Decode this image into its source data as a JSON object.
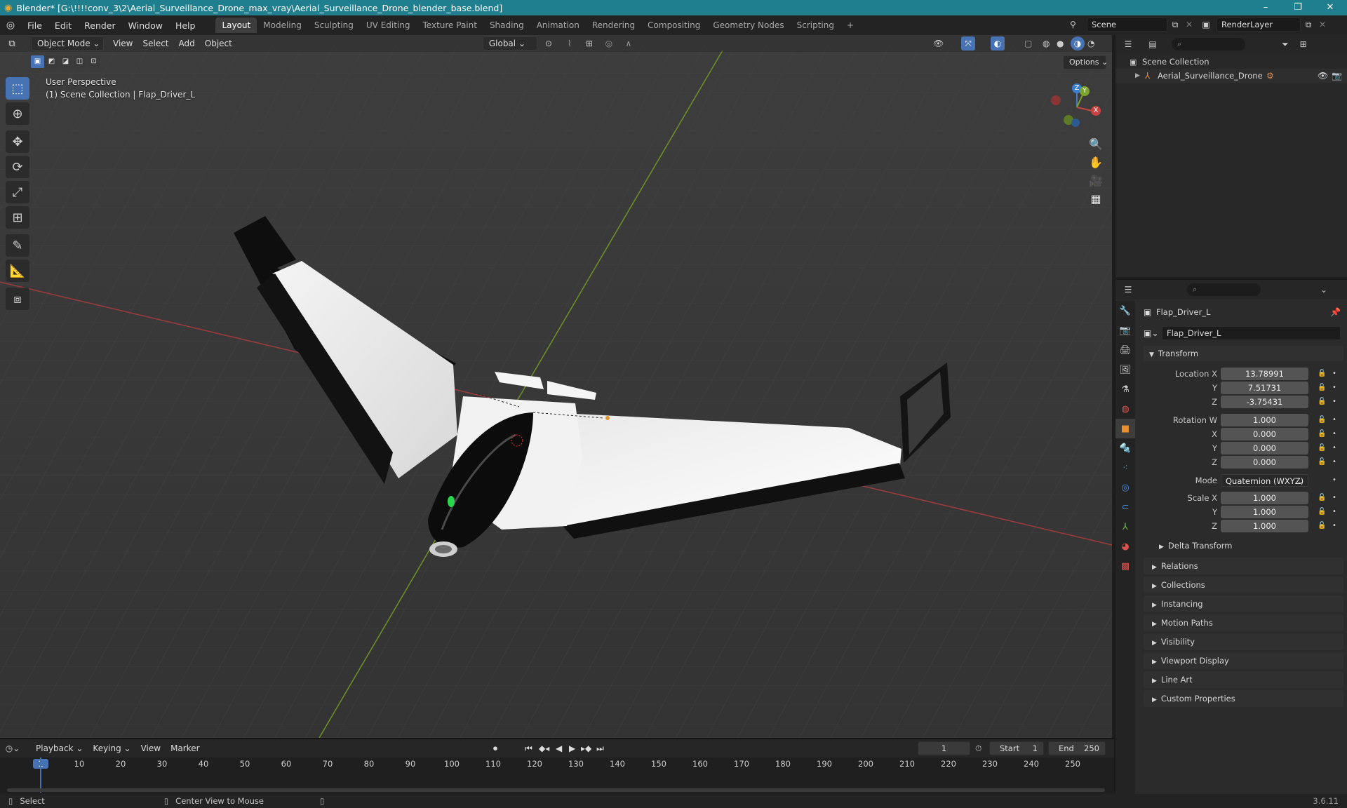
{
  "window": {
    "title": "Blender* [G:\\!!!!conv_3\\2\\Aerial_Surveillance_Drone_max_vray\\Aerial_Surveillance_Drone_blender_base.blend]",
    "minimize": "–",
    "restore": "❐",
    "close": "✕"
  },
  "menu": [
    "File",
    "Edit",
    "Render",
    "Window",
    "Help"
  ],
  "workspaces": {
    "tabs": [
      "Layout",
      "Modeling",
      "Sculpting",
      "UV Editing",
      "Texture Paint",
      "Shading",
      "Animation",
      "Rendering",
      "Compositing",
      "Geometry Nodes",
      "Scripting"
    ],
    "active": "Layout",
    "add": "+"
  },
  "scene": {
    "name": "Scene",
    "render_layer": "RenderLayer"
  },
  "viewport_header": {
    "mode": "Object Mode",
    "menus": [
      "View",
      "Select",
      "Add",
      "Object"
    ],
    "orientation": "Global",
    "options": "Options"
  },
  "viewport": {
    "perspective": "User Perspective",
    "collection_info": "(1) Scene Collection | Flap_Driver_L",
    "gizmo": {
      "z": "Z",
      "y": "Y",
      "x": "X"
    }
  },
  "outliner": {
    "scene_collection": "Scene Collection",
    "object": "Aerial_Surveillance_Drone"
  },
  "properties": {
    "object_name": "Flap_Driver_L",
    "datablock_name": "Flap_Driver_L",
    "transform": {
      "header": "Transform",
      "location_label": "Location X",
      "location": {
        "x": "13.78991",
        "y": "7.51731",
        "z": "-3.75431"
      },
      "rotation_label": "Rotation W",
      "rotation": {
        "w": "1.000",
        "x": "0.000",
        "y": "0.000",
        "z": "0.000"
      },
      "mode_label": "Mode",
      "mode": "Quaternion (WXYZ)",
      "scale_label": "Scale X",
      "scale": {
        "x": "1.000",
        "y": "1.000",
        "z": "1.000"
      },
      "axis_y": "Y",
      "axis_x": "X",
      "axis_z": "Z",
      "delta": "Delta Transform"
    },
    "sections": [
      "Relations",
      "Collections",
      "Instancing",
      "Motion Paths",
      "Visibility",
      "Viewport Display",
      "Line Art",
      "Custom Properties"
    ]
  },
  "timeline": {
    "menus": [
      "Playback",
      "Keying",
      "View",
      "Marker"
    ],
    "current_frame": "1",
    "start_label": "Start",
    "start": "1",
    "end_label": "End",
    "end": "250",
    "ruler": [
      "1",
      "10",
      "20",
      "30",
      "40",
      "50",
      "60",
      "70",
      "80",
      "90",
      "100",
      "110",
      "120",
      "130",
      "140",
      "150",
      "160",
      "170",
      "180",
      "190",
      "200",
      "210",
      "220",
      "230",
      "240",
      "250"
    ]
  },
  "statusbar": {
    "select": "Select",
    "center": "Center View to Mouse",
    "version": "3.6.11"
  },
  "colors": {
    "accent": "#4772b3",
    "titlebar": "#1f7f8f",
    "x_axis": "#c8423f",
    "y_axis": "#7ba32a",
    "z_axis": "#3b7fd3"
  }
}
